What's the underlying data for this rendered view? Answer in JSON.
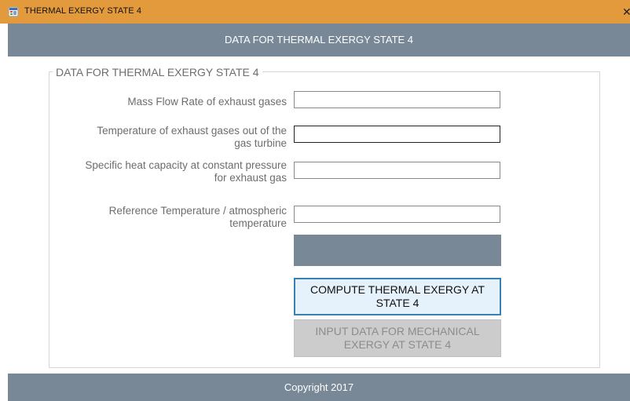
{
  "window": {
    "title": "THERMAL EXERGY STATE 4",
    "close_glyph": "✕",
    "icon": "app-window-icon"
  },
  "header": {
    "text": "DATA FOR THERMAL EXERGY STATE 4"
  },
  "group": {
    "legend": "DATA FOR THERMAL EXERGY STATE 4",
    "fields": [
      {
        "label": "Mass Flow Rate of exhaust gases",
        "value": ""
      },
      {
        "label": "Temperature of exhaust gases out of the gas turbine",
        "value": ""
      },
      {
        "label": "Specific heat capacity at constant pressure for exhaust gas",
        "value": ""
      },
      {
        "label": "Reference Temperature / atmospheric temperature",
        "value": ""
      }
    ],
    "result_value": "",
    "compute_button": "COMPUTE THERMAL EXERGY AT STATE 4",
    "mechanical_button": "INPUT DATA FOR MECHANICAL EXERGY AT STATE 4"
  },
  "footer": {
    "text": "Copyright 2017"
  },
  "colors": {
    "titlebar": "#e39a3d",
    "header": "#798896",
    "footer": "#798896",
    "button_focus_border": "#3c7fb1",
    "disabled_button": "#cccccc"
  }
}
